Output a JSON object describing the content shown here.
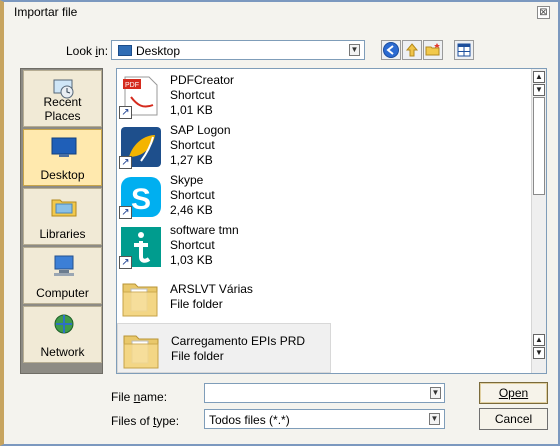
{
  "window": {
    "title": "Importar file",
    "close_label": "⊠"
  },
  "lookin": {
    "label": "Look in:",
    "value": "Desktop"
  },
  "toolbar": {
    "back_icon": "back-arrow-icon",
    "up_icon": "up-folder-icon",
    "new_folder_icon": "new-folder-icon",
    "view_icon": "view-menu-icon"
  },
  "places": [
    {
      "label": "Recent Places"
    },
    {
      "label": "Desktop"
    },
    {
      "label": "Libraries"
    },
    {
      "label": "Computer"
    },
    {
      "label": "Network"
    }
  ],
  "files": [
    {
      "name": "PDFCreator",
      "type": "Shortcut",
      "size": "1,01 KB"
    },
    {
      "name": "SAP Logon",
      "type": "Shortcut",
      "size": "1,27 KB"
    },
    {
      "name": "Skype",
      "type": "Shortcut",
      "size": "2,46 KB"
    },
    {
      "name": "software tmn",
      "type": "Shortcut",
      "size": "1,03 KB"
    },
    {
      "name": "ARSLVT Várias",
      "type": "File folder"
    },
    {
      "name": "Carregamento EPIs PRD",
      "type": "File folder"
    }
  ],
  "filename": {
    "label": "File name:",
    "value": ""
  },
  "filetype": {
    "label": "Files of type:",
    "value": "Todos files (*.*)"
  },
  "buttons": {
    "open": "Open",
    "cancel": "Cancel"
  },
  "colors": {
    "accent": "#7b98bf",
    "selection": "#ffe9ae",
    "places_bg": "#8d8b84"
  }
}
